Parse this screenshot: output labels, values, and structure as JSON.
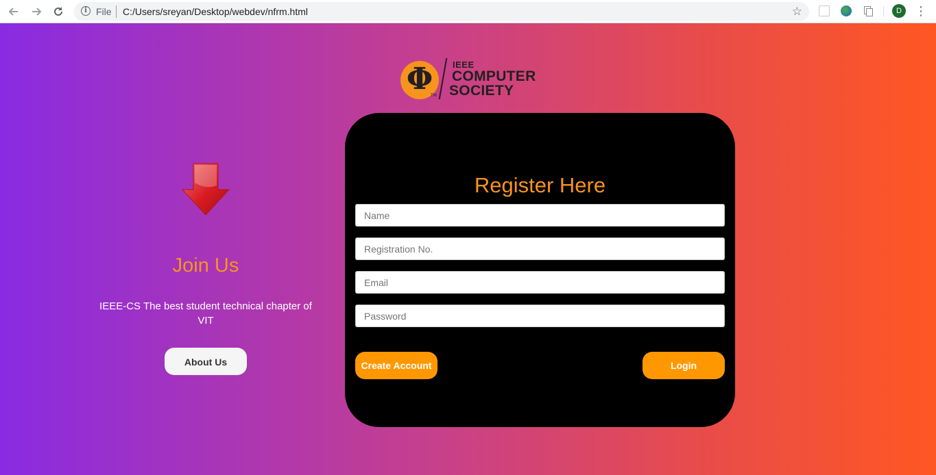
{
  "browser": {
    "scheme_label": "File",
    "url": "C:/Users/sreyan/Desktop/webdev/nfrm.html",
    "profile_initial": "D",
    "icons": {
      "back": "arrow-left-icon",
      "forward": "arrow-right-icon",
      "reload": "reload-icon",
      "info": "info-icon",
      "bookmark": "star-icon",
      "menu": "kebab-menu-icon"
    }
  },
  "logo": {
    "symbol": "Φ",
    "tm": "TM",
    "org": "IEEE",
    "line1": "COMPUTER",
    "line2": "SOCIETY"
  },
  "left": {
    "arrow_icon": "down-arrow-icon",
    "title": "Join Us",
    "description": "IEEE-CS The best student technical chapter of VIT",
    "about_button": "About Us"
  },
  "form": {
    "title": "Register Here",
    "fields": [
      {
        "placeholder": "Name"
      },
      {
        "placeholder": "Registration No."
      },
      {
        "placeholder": "Email"
      },
      {
        "placeholder": "Password"
      }
    ],
    "create_button": "Create Account",
    "login_button": "Login"
  },
  "colors": {
    "accent": "#f7941d",
    "button": "#ff9800",
    "card": "#000000",
    "gradient_start": "#8a2be2",
    "gradient_end": "#ff5722"
  }
}
